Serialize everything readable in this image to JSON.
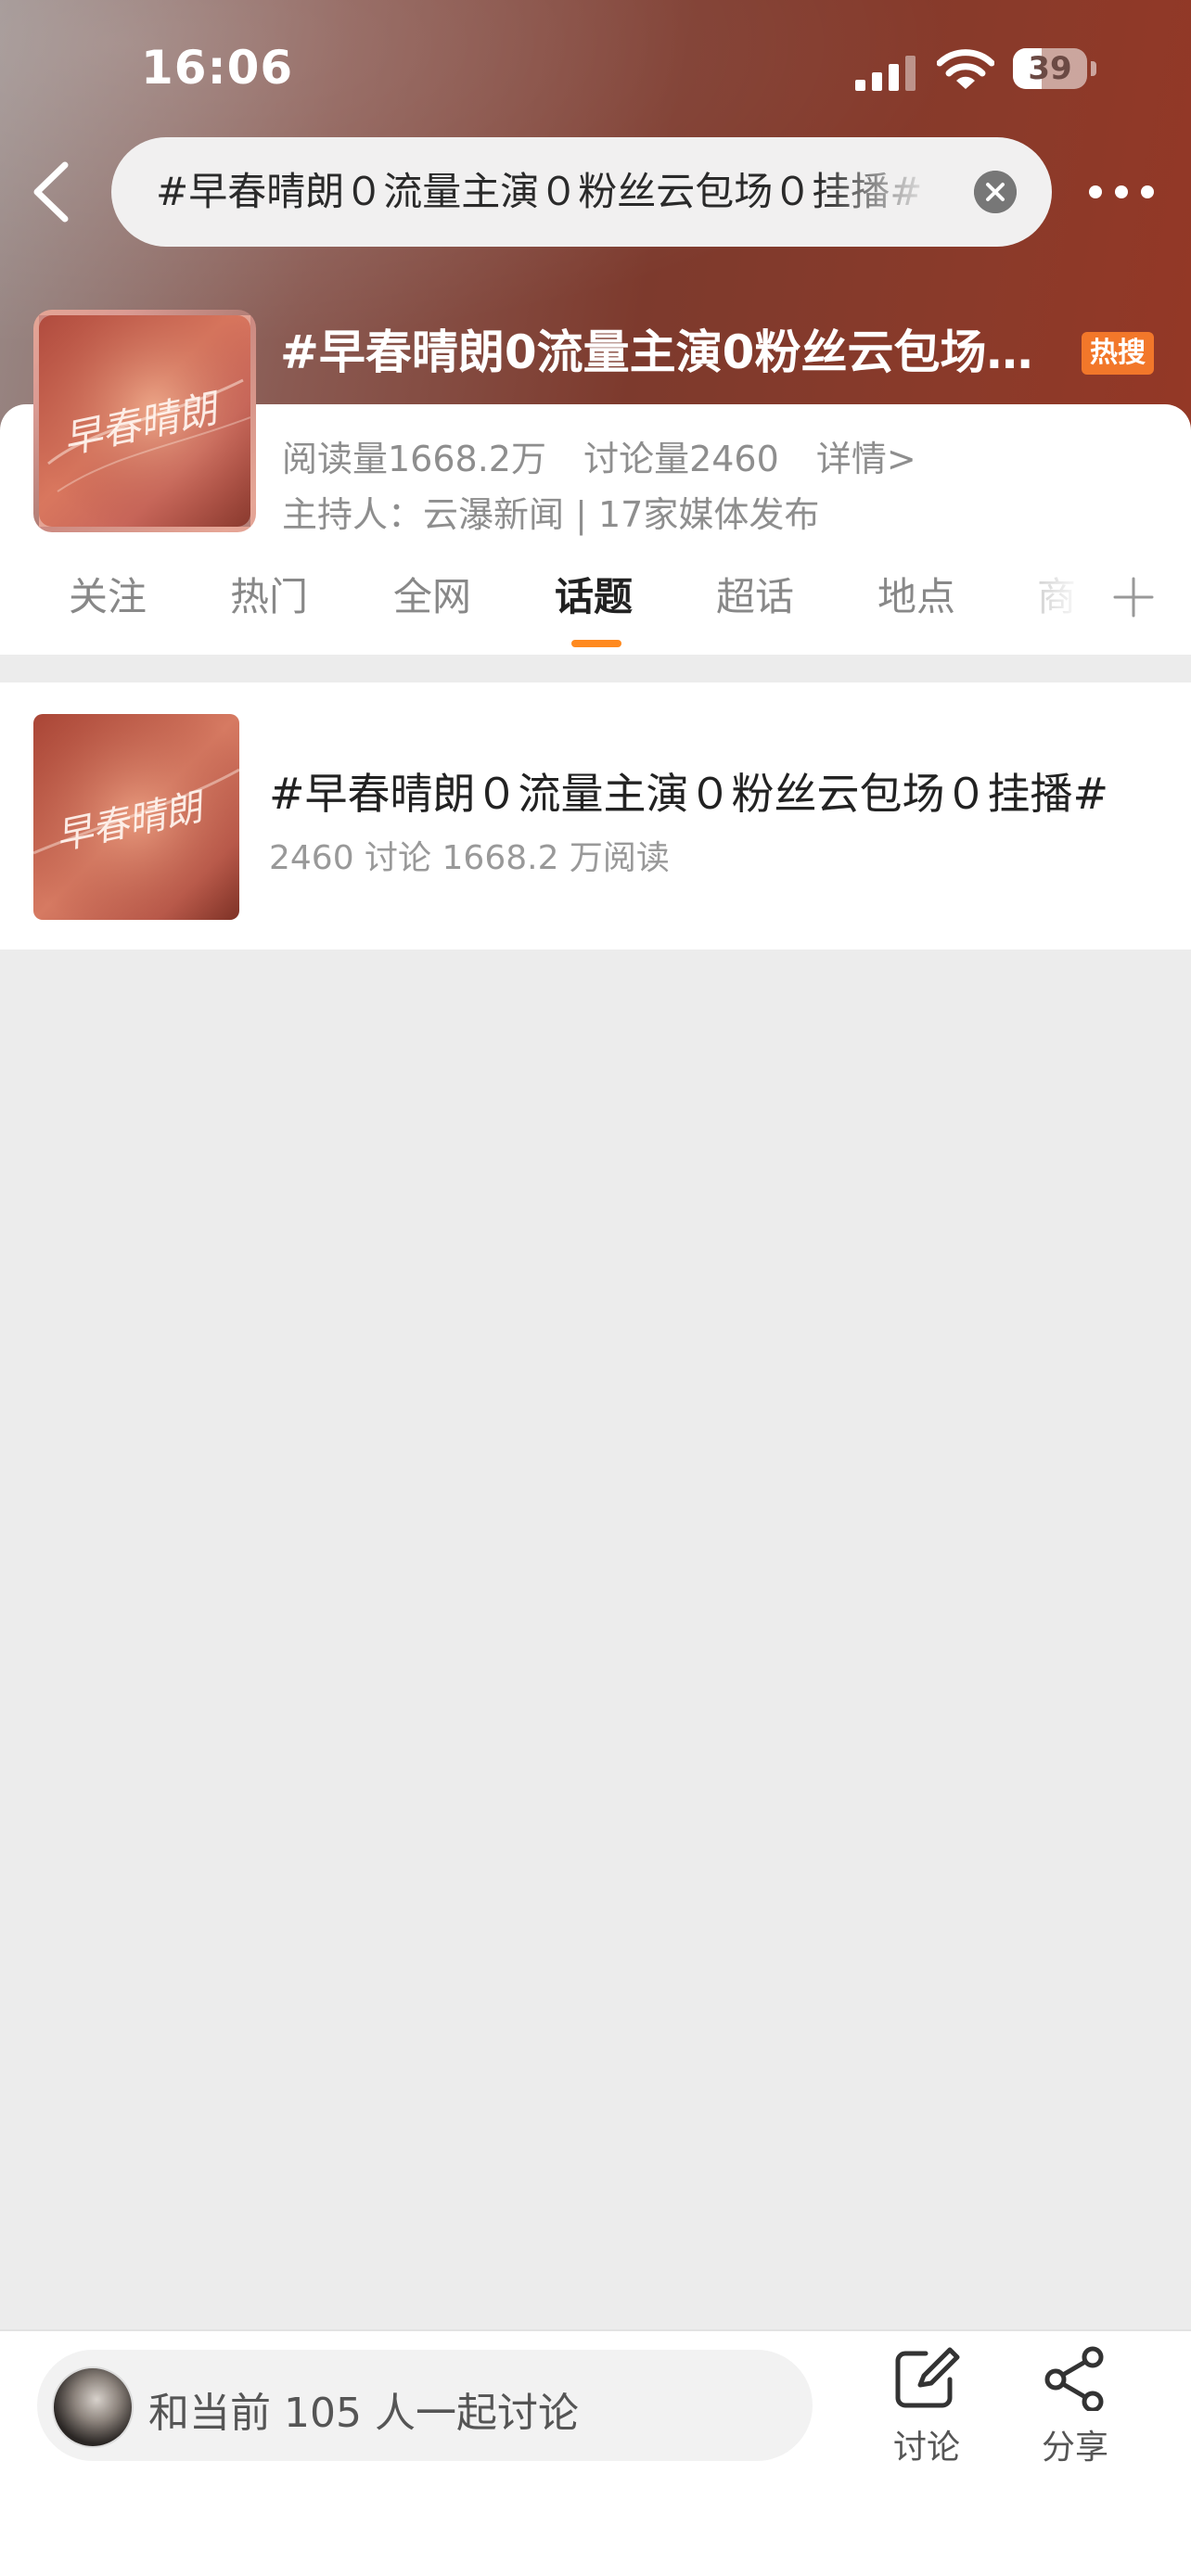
{
  "status_bar": {
    "time": "16:06",
    "battery": "39",
    "battery_level": 0.39
  },
  "search": {
    "query": "#早春晴朗０流量主演０粉丝云包场０挂播#"
  },
  "topic": {
    "title": "#早春晴朗0流量主演0粉丝云包场0挂播#",
    "badge": "热搜",
    "reads": "阅读量1668.2万",
    "discussions": "讨论量2460",
    "details_link": "详情>",
    "host": "主持人：云瀑新闻 | 17家媒体发布",
    "cover_text": "早春晴朗"
  },
  "tabs": [
    {
      "label": "关注"
    },
    {
      "label": "热门"
    },
    {
      "label": "全网"
    },
    {
      "label": "话题",
      "active": true
    },
    {
      "label": "超话"
    },
    {
      "label": "地点"
    },
    {
      "label": "商"
    }
  ],
  "results": [
    {
      "title": "#早春晴朗０流量主演０粉丝云包场０挂播#",
      "meta": "2460 讨论 1668.2 万阅读",
      "cover_text": "早春晴朗"
    }
  ],
  "bottom_bar": {
    "compose_placeholder": "和当前 105 人一起讨论",
    "discuss_label": "讨论",
    "share_label": "分享"
  },
  "colors": {
    "accent": "#ff8a1f",
    "badge": "#f2772a"
  }
}
